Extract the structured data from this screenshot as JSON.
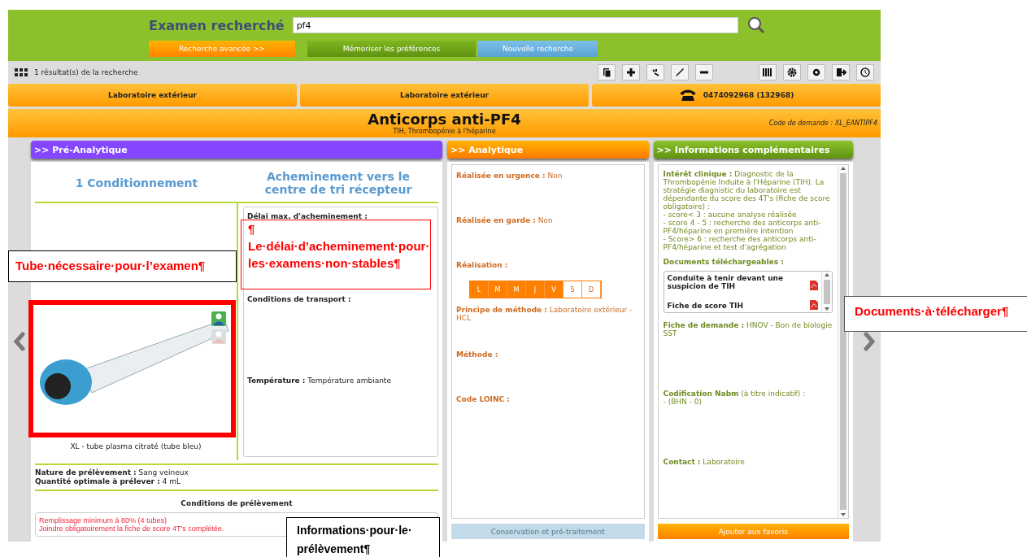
{
  "search": {
    "title": "Examen recherché",
    "value": "pf4"
  },
  "search_buttons": [
    {
      "label": "Recherche avancée >>",
      "kind": "orange"
    },
    {
      "label": "Mémoriser les préférences",
      "kind": "green"
    },
    {
      "label": "Nouvelle recherche",
      "kind": "blue"
    }
  ],
  "results": "1 résultat(s) de la recherche",
  "lab_bars": [
    {
      "label": "Laboratoire extérieur",
      "kind": "text"
    },
    {
      "label": "Laboratoire extérieur",
      "kind": "text"
    },
    {
      "label": "0474092968 (132968)",
      "kind": "phone"
    }
  ],
  "exam": {
    "title": "Anticorps anti-PF4",
    "subtitle": "TIH, Thrombopénie à l'héparine",
    "code": "Code de demande : XL_EANTIPF4"
  },
  "pre_analytique": {
    "header": ">> Pré-Analytique",
    "conditioning_title": "1 Conditionnement",
    "transport_title": "Acheminement vers le centre de tri récepteur",
    "tube_caption": "XL - tube plasma citraté (tube bleu)",
    "transport_fields": [
      {
        "label": "Délai max. d'acheminement :"
      },
      {
        "label": "Conditions de transport :"
      },
      {
        "label": "Température :",
        "value": "Température ambiante"
      }
    ],
    "sample_fields": [
      {
        "label": "Nature de prélèvement :",
        "value": "Sang veineux"
      },
      {
        "label": "Quantité optimale à prélever :",
        "value": "4 mL"
      }
    ],
    "conditions_title": "Conditions de prélèvement",
    "conditions": [
      "Remplissage minimum à 80% (4 tubes)",
      "Joindre obligatoirement la fiche de score 4T's complétée."
    ]
  },
  "analytique": {
    "header": ">> Analytique",
    "fields": [
      {
        "kind": "text",
        "label": "Réalisée en urgence :",
        "value": "Non"
      },
      {
        "kind": "text",
        "label": "Réalisée en garde :",
        "value": "Non"
      },
      {
        "kind": "days",
        "label": "Réalisation :",
        "days": [
          {
            "label": "L",
            "active": true
          },
          {
            "label": "M",
            "active": true
          },
          {
            "label": "M",
            "active": true
          },
          {
            "label": "J",
            "active": true
          },
          {
            "label": "V",
            "active": true
          },
          {
            "label": "S",
            "active": false
          },
          {
            "label": "D",
            "active": false
          }
        ]
      },
      {
        "kind": "text",
        "label": "Principe de méthode :",
        "value": "Laboratoire extérieur - HCL"
      },
      {
        "kind": "text",
        "label": "Méthode :"
      },
      {
        "kind": "text",
        "label": "Code LOINC :"
      }
    ]
  },
  "informations": {
    "header": ">> Informations complémentaires",
    "clinical_label": "Intérêt clinique :",
    "clinical_lines": [
      "Diagnostic de la Thrombopénie Induite à l'Héparine (TIH). La stratégie diagnistic du laboratoire est dépendante du score des 4T's (fiche de score obligatoire) :",
      "- score< 3 : aucune analyse réalisée",
      "- score 4 - 5 : recherche des anticorps anti-PF4/héparine en première intention",
      "- Score> 6 : recherche des anticorps anti-PF4/héparine et test d'agrégation"
    ],
    "documents_label": "Documents téléchargeables :",
    "documents": [
      {
        "title": "Conduite à tenir devant une suspicion de TIH"
      },
      {
        "title": "Fiche de score TIH"
      }
    ],
    "request_label": "Fiche de demande :",
    "request_value": "HNOV - Bon de biologie SST",
    "nabm_label": "Codification Nabm",
    "nabm_note": "(à titre indicatif) :",
    "nabm_value": "- (BHN - 0)",
    "contact_label": "Contact :",
    "contact_value": "Laboratoire"
  },
  "bottom_buttons": [
    {
      "label": "Conservation et pré-traitement",
      "disabled": true
    },
    {
      "label": "Ajouter aux favoris",
      "disabled": false
    }
  ],
  "annotations": [
    {
      "lines": [
        "Tube·nécessaire·pour·l’examen¶"
      ]
    },
    {
      "lines": [
        "¶",
        "Le·délai·d’acheminement·pour·les·examens·non·stables¶"
      ]
    },
    {
      "lines": [
        "Documents·à·télécharger¶"
      ]
    },
    {
      "lines": [
        "Informations·pour·le·prélèvement¶"
      ]
    }
  ]
}
